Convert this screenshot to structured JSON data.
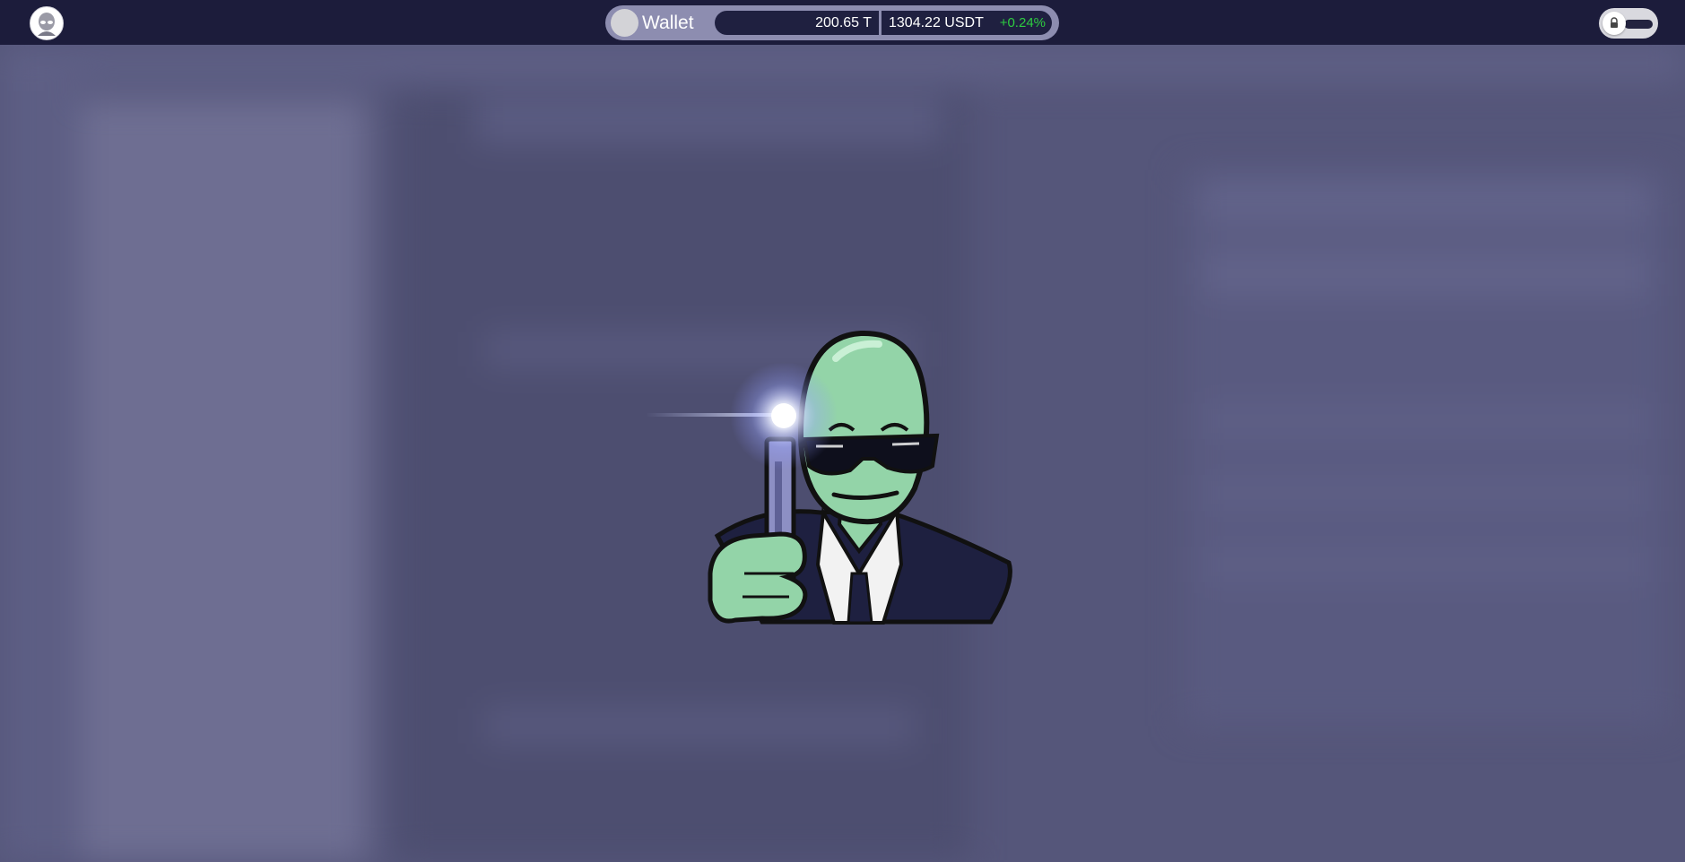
{
  "header": {
    "logo_icon": "alien-avatar-icon",
    "wallet": {
      "label": "Wallet",
      "balance": "200.65 T",
      "usdt_value": "1304.22 USDT",
      "change": "+0.24%",
      "change_color": "#2ecc40"
    },
    "lock_toggle_icon": "lock-icon"
  },
  "loading": {
    "mascot_icon": "alien-agent-flashlight-icon"
  },
  "colors": {
    "topbar": "#1c1c3b",
    "background": "#55567a",
    "accent_green": "#2ecc40",
    "alien_skin": "#93d4a8"
  }
}
